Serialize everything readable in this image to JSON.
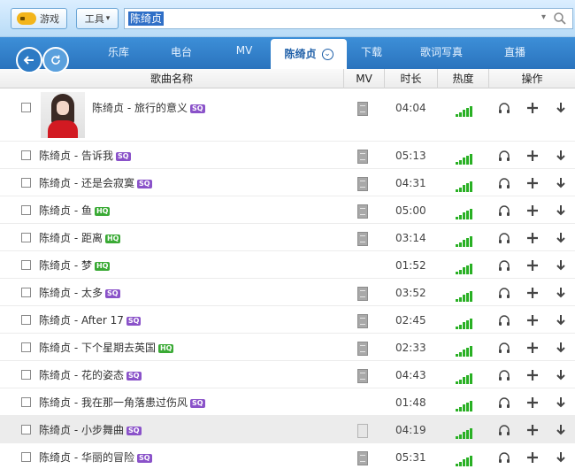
{
  "colors": {
    "accent": "#2f7bc6",
    "heat_bar": "#29b024",
    "badge_sq": "#8a52c9",
    "badge_hq": "#3aaa35"
  },
  "topbar": {
    "game_label": "游戏",
    "tool_label": "工具",
    "tool_arrow": "▾",
    "search_value": "陈绮贞",
    "search_dropdown": "▾"
  },
  "nav": {
    "back_icon": "←",
    "refresh_icon": "↻",
    "tabs": [
      {
        "label": "乐库"
      },
      {
        "label": "电台"
      },
      {
        "label": "MV"
      },
      {
        "label": "陈绮贞",
        "active": true
      },
      {
        "label": "下载"
      },
      {
        "label": "歌词写真"
      },
      {
        "label": "直播"
      }
    ]
  },
  "table": {
    "headers": {
      "name": "歌曲名称",
      "mv": "MV",
      "duration": "时长",
      "heat": "热度",
      "ops": "操作"
    },
    "rows": [
      {
        "title": "陈绮贞 - 旅行的意义",
        "badge": "SQ",
        "duration": "04:04",
        "mv": true,
        "thumb": true
      },
      {
        "title": "陈绮贞 - 告诉我",
        "badge": "SQ",
        "duration": "05:13",
        "mv": true
      },
      {
        "title": "陈绮贞 - 还是会寂寞",
        "badge": "SQ",
        "duration": "04:31",
        "mv": true
      },
      {
        "title": "陈绮贞 - 鱼",
        "badge": "HQ",
        "duration": "05:00",
        "mv": true
      },
      {
        "title": "陈绮贞 - 距离",
        "badge": "HQ",
        "duration": "03:14",
        "mv": true
      },
      {
        "title": "陈绮贞 - 梦",
        "badge": "HQ",
        "duration": "01:52",
        "mv": false
      },
      {
        "title": "陈绮贞 - 太多",
        "badge": "SQ",
        "duration": "03:52",
        "mv": true
      },
      {
        "title": "陈绮贞 - After 17",
        "badge": "SQ",
        "duration": "02:45",
        "mv": true
      },
      {
        "title": "陈绮贞 - 下个星期去英国",
        "badge": "HQ",
        "duration": "02:33",
        "mv": true
      },
      {
        "title": "陈绮贞 - 花的姿态",
        "badge": "SQ",
        "duration": "04:43",
        "mv": true
      },
      {
        "title": "陈绮贞 - 我在那一角落患过伤风",
        "badge": "SQ",
        "duration": "01:48",
        "mv": false
      },
      {
        "title": "陈绮贞 - 小步舞曲",
        "badge": "SQ",
        "duration": "04:19",
        "mv": true,
        "mv_light": true,
        "selected": true
      },
      {
        "title": "陈绮贞 - 华丽的冒险",
        "badge": "SQ",
        "duration": "05:31",
        "mv": true
      }
    ]
  }
}
